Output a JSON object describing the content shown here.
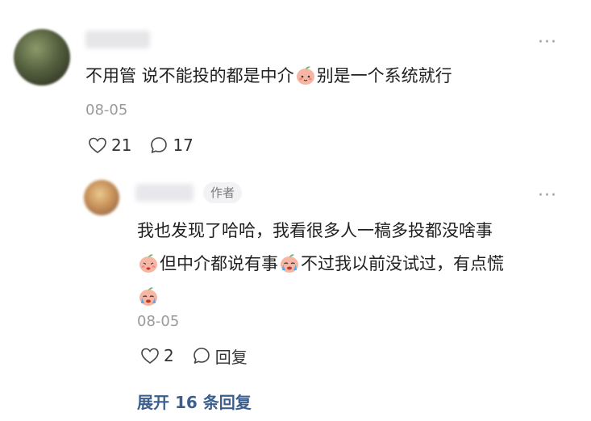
{
  "top_comment": {
    "username": "",
    "text_parts": [
      "不用管 说不能投的都是中介",
      "别是一个系统就行"
    ],
    "date": "08-05",
    "likes": "21",
    "comments": "17",
    "more_label": "···"
  },
  "reply": {
    "username": "",
    "author_badge": "作者",
    "text_line1": "我也发现了哈哈，我看很多人一稿多投都没啥事",
    "text_line2_a": "但中介都说有事",
    "text_line2_b": "不过我以前没试过，有点慌",
    "date": "08-05",
    "likes": "2",
    "reply_label": "回复",
    "more_label": "···"
  },
  "expand_label": "展开 16 条回复"
}
